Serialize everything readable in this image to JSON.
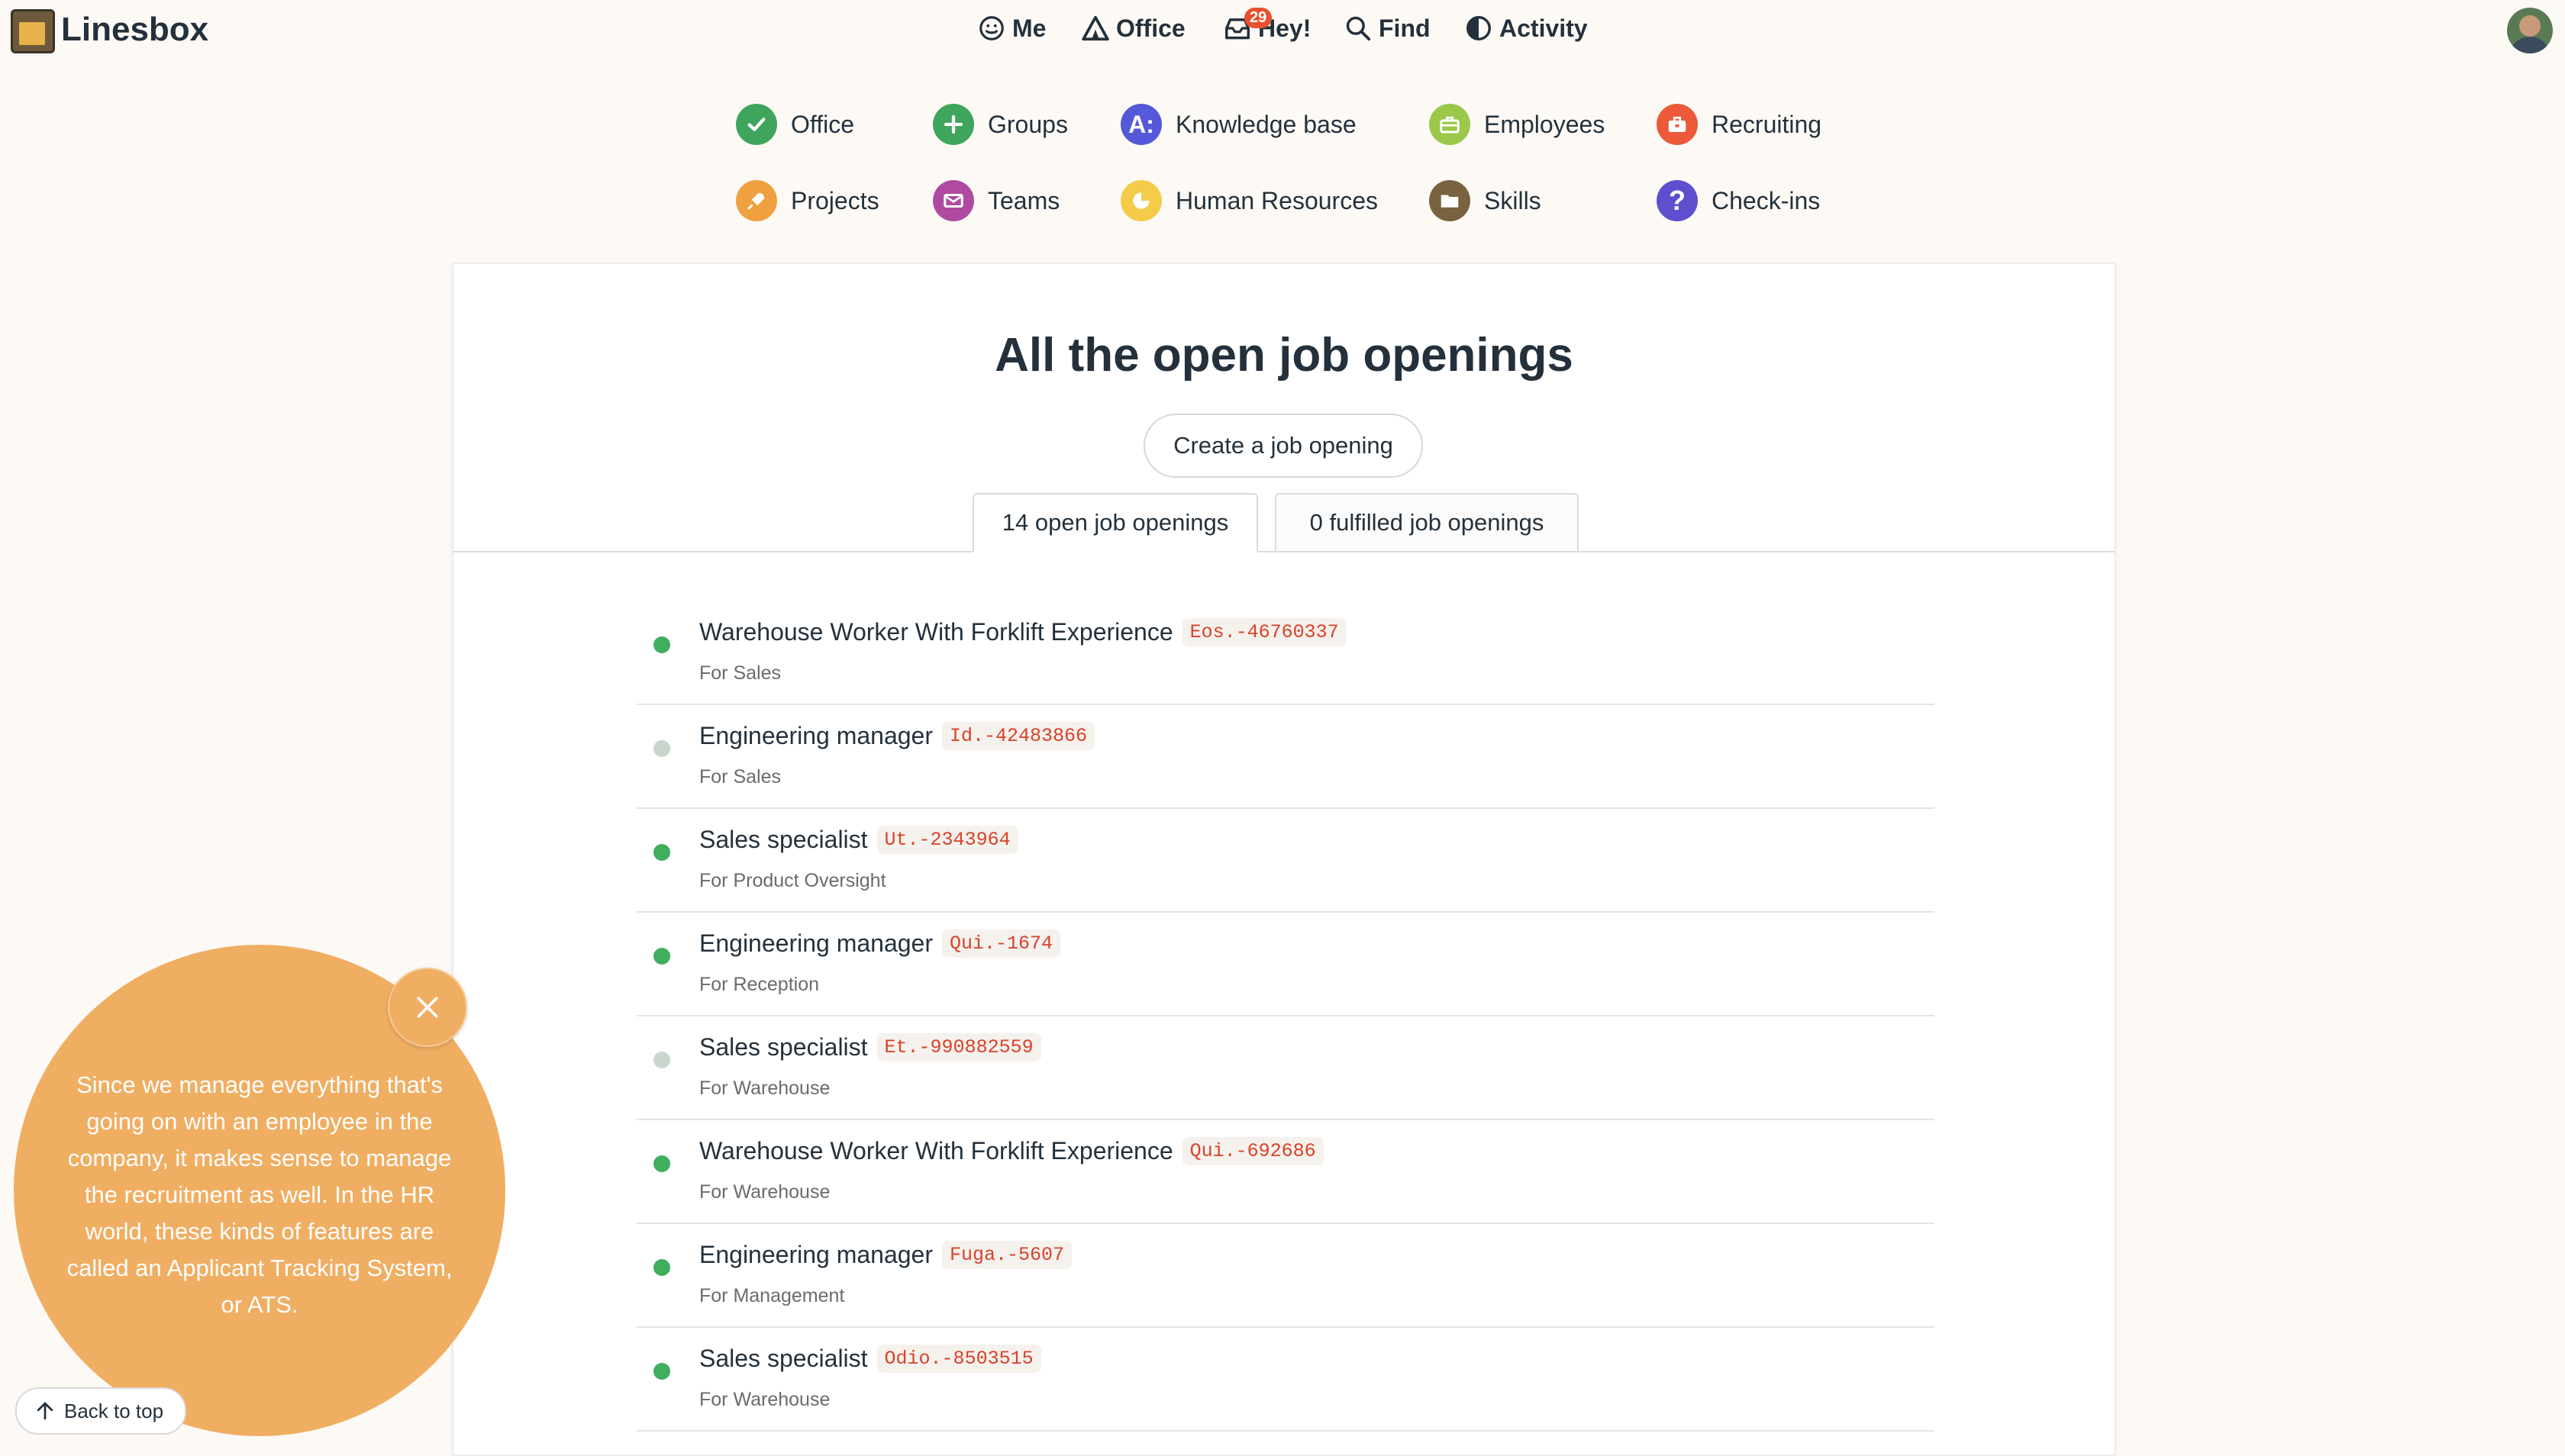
{
  "brand": {
    "name": "Linesbox"
  },
  "topnav": [
    {
      "label": "Me",
      "icon": "smiley-icon"
    },
    {
      "label": "Office",
      "icon": "office-tent-icon"
    },
    {
      "label": "Hey!",
      "icon": "hey-inbox-icon",
      "badge": "29"
    },
    {
      "label": "Find",
      "icon": "search-icon"
    },
    {
      "label": "Activity",
      "icon": "activity-icon"
    }
  ],
  "apps": [
    {
      "label": "Office",
      "icon": "check-icon",
      "color": "#3fa55c"
    },
    {
      "label": "Groups",
      "icon": "plus-icon",
      "color": "#3fa55c"
    },
    {
      "label": "Knowledge base",
      "icon": "knowledge-icon",
      "color": "#5558d8"
    },
    {
      "label": "Employees",
      "icon": "briefcase-icon",
      "color": "#9bc84a"
    },
    {
      "label": "Recruiting",
      "icon": "recruiting-icon",
      "color": "#ec5a3a"
    },
    {
      "label": "Projects",
      "icon": "rocket-icon",
      "color": "#f0a040"
    },
    {
      "label": "Teams",
      "icon": "envelope-icon",
      "color": "#b04aa0"
    },
    {
      "label": "Human Resources",
      "icon": "clock-icon",
      "color": "#f4cc4a"
    },
    {
      "label": "Skills",
      "icon": "folder-icon",
      "color": "#7a6240"
    },
    {
      "label": "Check-ins",
      "icon": "question-icon",
      "color": "#5f4fcf"
    }
  ],
  "main": {
    "title": "All the open job openings",
    "create_label": "Create a job opening",
    "tabs": [
      {
        "label": "14 open job openings",
        "active": true
      },
      {
        "label": "0 fulfilled job openings",
        "active": false
      }
    ],
    "jobs": [
      {
        "title": "Warehouse Worker With Forklift Experience",
        "code": "Eos.-46760337",
        "dept": "For Sales",
        "status_color": "#3fae5f"
      },
      {
        "title": "Engineering manager",
        "code": "Id.-42483866",
        "dept": "For Sales",
        "status_color": "#c9d6cc"
      },
      {
        "title": "Sales specialist",
        "code": "Ut.-2343964",
        "dept": "For Product Oversight",
        "status_color": "#3fae5f"
      },
      {
        "title": "Engineering manager",
        "code": "Qui.-1674",
        "dept": "For Reception",
        "status_color": "#3fae5f"
      },
      {
        "title": "Sales specialist",
        "code": "Et.-990882559",
        "dept": "For Warehouse",
        "status_color": "#c9d6cc"
      },
      {
        "title": "Warehouse Worker With Forklift Experience",
        "code": "Qui.-692686",
        "dept": "For Warehouse",
        "status_color": "#3fae5f"
      },
      {
        "title": "Engineering manager",
        "code": "Fuga.-5607",
        "dept": "For Management",
        "status_color": "#3fae5f"
      },
      {
        "title": "Sales specialist",
        "code": "Odio.-8503515",
        "dept": "For Warehouse",
        "status_color": "#3fae5f"
      }
    ]
  },
  "tooltip": {
    "text": "Since we manage everything that's going on with an employee in the company, it makes sense to manage the recruitment as well. In the HR world, these kinds of features are called an Applicant Tracking System, or ATS.",
    "back_to_top": "Back to top"
  }
}
